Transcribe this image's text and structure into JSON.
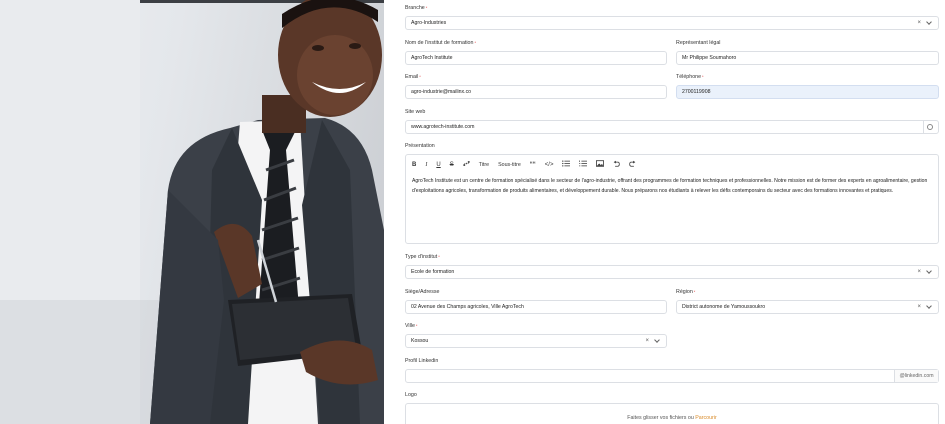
{
  "form": {
    "branche": {
      "label": "Branche",
      "required": "*",
      "value": "Agro-Industries"
    },
    "nom": {
      "label": "Nom de l'institut de formation",
      "required": "*",
      "value": "AgroTech Institute"
    },
    "representant": {
      "label": "Représentant légal",
      "value": "Mr Philippe Soumahoro"
    },
    "email": {
      "label": "Email",
      "required": "*",
      "value": "agro-industrie@mailinx.co"
    },
    "telephone": {
      "label": "Téléphone",
      "required": "*",
      "value": "2700119908"
    },
    "site": {
      "label": "Site web",
      "value": "www.agrotech-institute.com"
    },
    "presentation": {
      "label": "Présentation",
      "toolbar": {
        "bold": "B",
        "italic": "I",
        "underline": "U",
        "strike": "S",
        "title": "Titre",
        "subtitle": "Sous-titre",
        "quote": "““",
        "code": "</>"
      },
      "text": "AgroTech Institute est un centre de formation spécialisé dans le secteur de l'agro-industrie, offrant des programmes de formation techniques et professionnelles. Notre mission est de former des experts en agroalimentaire, gestion d'exploitations agricoles, transformation de produits alimentaires, et développement durable. Nous préparons nos étudiants à relever les défis contemporains du secteur avec des formations innovantes et pratiques."
    },
    "type": {
      "label": "Type d'institut",
      "required": "*",
      "value": "Ecole de formation"
    },
    "siege": {
      "label": "Siège/Adresse",
      "value": "02 Avenue des Champs agricoles, Ville AgroTech"
    },
    "region": {
      "label": "Région",
      "required": "*",
      "value": "District autonome de Yamoussoukro"
    },
    "ville": {
      "label": "Ville",
      "required": "*",
      "value": "Kossou"
    },
    "linkedin": {
      "label": "Profil Linkedin",
      "value": "",
      "suffix": "@linkedin.com"
    },
    "logo": {
      "label": "Logo",
      "drop_text": "Faites glisser vos fichiers ou ",
      "drop_link": "Parcourir"
    }
  },
  "colors": {
    "highlight": "#eaf1fb",
    "link": "#d98b2a",
    "border": "#dcdfe4"
  }
}
